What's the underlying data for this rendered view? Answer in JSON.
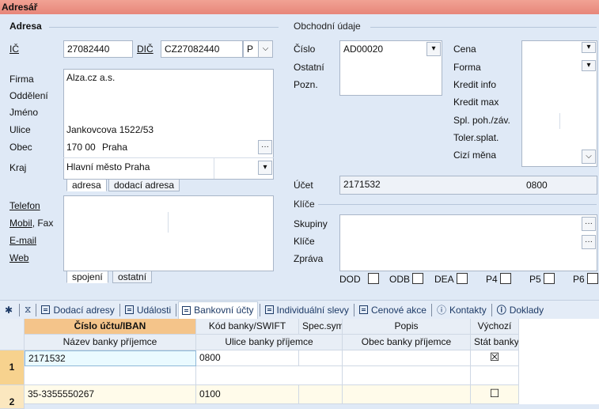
{
  "window": {
    "title": "Adresář"
  },
  "address": {
    "group_label": "Adresa",
    "ic_label": "IČ",
    "ic_value": "27082440",
    "dic_label": "DIČ",
    "dic_value": "CZ27082440",
    "dic_suffix": "P",
    "firma_label": "Firma",
    "firma_value": "Alza.cz a.s.",
    "oddeleni_label": "Oddělení",
    "jmeno_label": "Jméno",
    "ulice_label": "Ulice",
    "ulice_value": "Jankovcova 1522/53",
    "obec_label": "Obec",
    "psc_value": "170 00",
    "obec_value": "Praha",
    "kraj_label": "Kraj",
    "kraj_value": "Hlavní město Praha",
    "tabs": [
      "adresa",
      "dodací adresa"
    ],
    "telefon_label": "Telefon",
    "mobil_label": "Mobil",
    "fax_label": ", Fax",
    "email_label": "E-mail",
    "web_label": "Web",
    "contact_tabs": [
      "spojení",
      "ostatní"
    ]
  },
  "business": {
    "group_label": "Obchodní údaje",
    "cislo_label": "Číslo",
    "cislo_value": "AD00020",
    "ostatni_label": "Ostatní",
    "pozn_label": "Pozn.",
    "cena_label": "Cena",
    "forma_label": "Forma",
    "kredit_info_label": "Kredit info",
    "kredit_max_label": "Kredit max",
    "spl_label": "Spl. poh./záv.",
    "toler_label": "Toler.splat.",
    "cizi_mena_label": "Cizí měna",
    "ucet_label": "Účet",
    "ucet_value": "2171532",
    "ucet_bank": "0800",
    "klice_section": "Klíče",
    "skupiny_label": "Skupiny",
    "klice_label": "Klíče",
    "zprava_label": "Zpráva",
    "flags": [
      "DOD",
      "ODB",
      "DEA",
      "P4",
      "P5",
      "P6"
    ]
  },
  "toolbar": {
    "star": "✱",
    "items": [
      "Dodací adresy",
      "Události",
      "Bankovní účty",
      "Individuální slevy",
      "Cenové akce",
      "Kontakty",
      "Doklady"
    ]
  },
  "grid": {
    "headers_top": [
      "Číslo účtu/IBAN",
      "Kód banky/SWIFT",
      "Spec.sym",
      "Popis",
      "Výchozí"
    ],
    "headers_bottom": [
      "Název banky příjemce",
      "Ulice banky příjemce",
      "Obec banky příjemce",
      "Stát banky"
    ],
    "rows": [
      {
        "num": "1",
        "account": "2171532",
        "bank": "0800",
        "default": "☒"
      },
      {
        "num": "2",
        "account": "35-3355550267",
        "bank": "0100",
        "default": "☐"
      }
    ]
  }
}
